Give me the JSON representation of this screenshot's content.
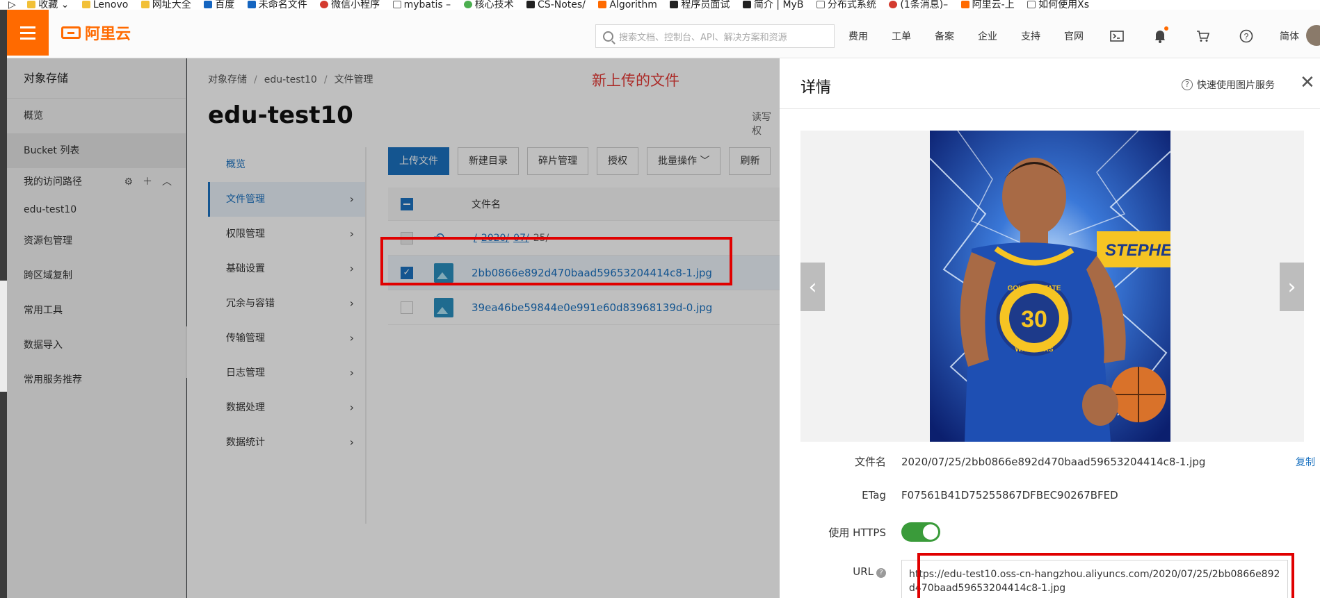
{
  "bookmarks": [
    {
      "label": "收藏",
      "icon": "star-icon"
    },
    {
      "label": "Lenovo",
      "icon": "folder-icon"
    },
    {
      "label": "网址大全",
      "icon": "folder-icon"
    },
    {
      "label": "百度",
      "icon": "baidu-icon"
    },
    {
      "label": "未命名文件",
      "icon": "onenote-icon"
    },
    {
      "label": "微信小程序",
      "icon": "csdn-icon"
    },
    {
      "label": "mybatis –",
      "icon": "doc-icon"
    },
    {
      "label": "核心技术",
      "icon": "spring-icon"
    },
    {
      "label": "CS-Notes/",
      "icon": "github-icon"
    },
    {
      "label": "Algorithm",
      "icon": "algo-icon"
    },
    {
      "label": "程序员面试",
      "icon": "site-icon"
    },
    {
      "label": "简介 | MyB",
      "icon": "bird-icon"
    },
    {
      "label": "分布式系统",
      "icon": "doc-icon"
    },
    {
      "label": "(1条消息)–",
      "icon": "csdn-icon"
    },
    {
      "label": "阿里云-上",
      "icon": "aliyun-icon"
    },
    {
      "label": "如何使用Xs",
      "icon": "doc-icon"
    }
  ],
  "header": {
    "brand": "阿里云",
    "search_placeholder": "搜索文档、控制台、API、解决方案和资源",
    "nav": [
      "费用",
      "工单",
      "备案",
      "企业",
      "支持",
      "官网"
    ],
    "lang": "简体",
    "icons": [
      "terminal-icon",
      "bell-icon",
      "cart-icon",
      "help-icon"
    ]
  },
  "sidebar": {
    "title": "对象存储",
    "items": [
      "概览",
      "Bucket 列表"
    ],
    "access_path_label": "我的访问路径",
    "bucket_link": "edu-test10",
    "more_items": [
      "资源包管理",
      "跨区域复制",
      "常用工具",
      "数据导入",
      "常用服务推荐"
    ]
  },
  "breadcrumb": [
    "对象存储",
    "edu-test10",
    "文件管理"
  ],
  "annotation": "新上传的文件",
  "page_title": "edu-test10",
  "rw_label": "读写权",
  "subnav": [
    "概览",
    "文件管理",
    "权限管理",
    "基础设置",
    "冗余与容错",
    "传输管理",
    "日志管理",
    "数据处理",
    "数据统计"
  ],
  "toolbar": [
    "上传文件",
    "新建目录",
    "碎片管理",
    "授权",
    "批量操作",
    "刷新"
  ],
  "table": {
    "col_filename": "文件名",
    "path_parts": [
      "/",
      "2020/",
      "07/",
      "25/"
    ],
    "files": [
      {
        "name": "2bb0866e892d470baad59653204414c8-1.jpg",
        "checked": true
      },
      {
        "name": "39ea46be59844e0e991e60d83968139d-0.jpg",
        "checked": false
      }
    ]
  },
  "drawer": {
    "title": "详情",
    "help_link": "快速使用图片服务",
    "fields": {
      "filename_label": "文件名",
      "filename_value": "2020/07/25/2bb0866e892d470baad59653204414c8-1.jpg",
      "copy_label": "复制",
      "etag_label": "ETag",
      "etag_value": "F07561B41D75255867DFBEC90267BFED",
      "https_label": "使用 HTTPS",
      "https_enabled": true,
      "url_label": "URL",
      "url_value": "https://edu-test10.oss-cn-hangzhou.aliyuncs.com/2020/07/25/2bb0866e892d470baad59653204414c8-1.jpg"
    },
    "image_text": {
      "jersey_team": "GOLDEN STATE",
      "jersey_number": "30",
      "jersey_name": "WARRIORS",
      "banner": "STEPHEN"
    }
  },
  "colors": {
    "brand_orange": "#ff6a00",
    "link_blue": "#1b72c0",
    "annotation_red": "#e00000",
    "toggle_green": "#3a9b3a"
  }
}
